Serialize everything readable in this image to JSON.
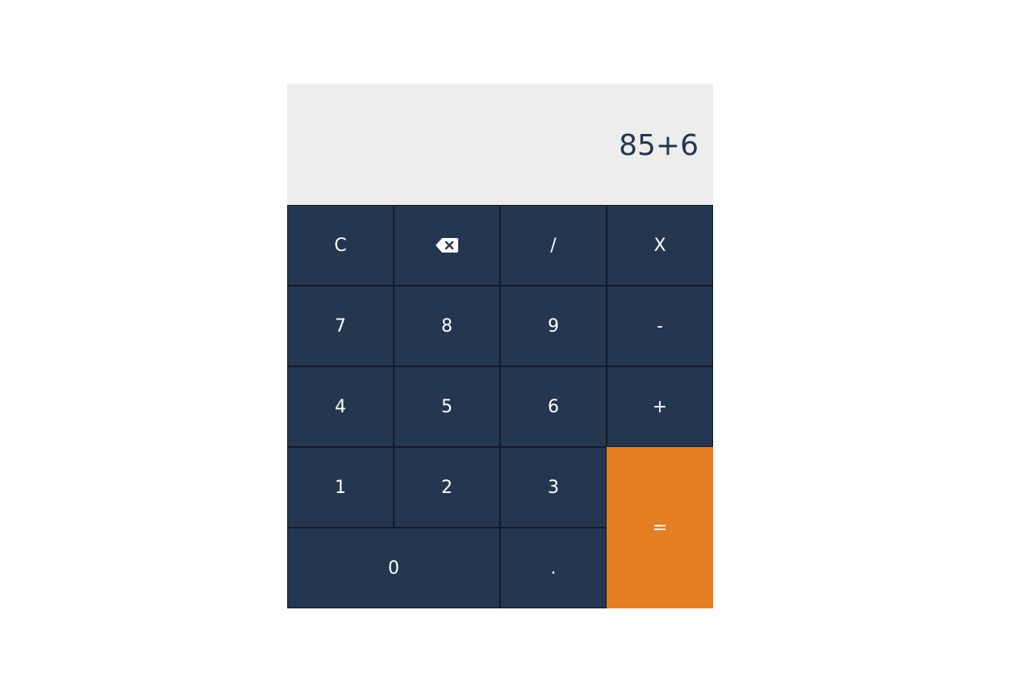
{
  "display": {
    "expression": "85+6"
  },
  "keys": {
    "clear": "C",
    "backspace_icon": "backspace-icon",
    "divide": "/",
    "multiply": "X",
    "seven": "7",
    "eight": "8",
    "nine": "9",
    "minus": "-",
    "four": "4",
    "five": "5",
    "six": "6",
    "plus": "+",
    "one": "1",
    "two": "2",
    "three": "3",
    "equals": "=",
    "zero": "0",
    "dot": "."
  },
  "colors": {
    "key_background": "#243650",
    "equals_background": "#e67f21",
    "display_background": "#ededed",
    "display_text": "#243650"
  }
}
